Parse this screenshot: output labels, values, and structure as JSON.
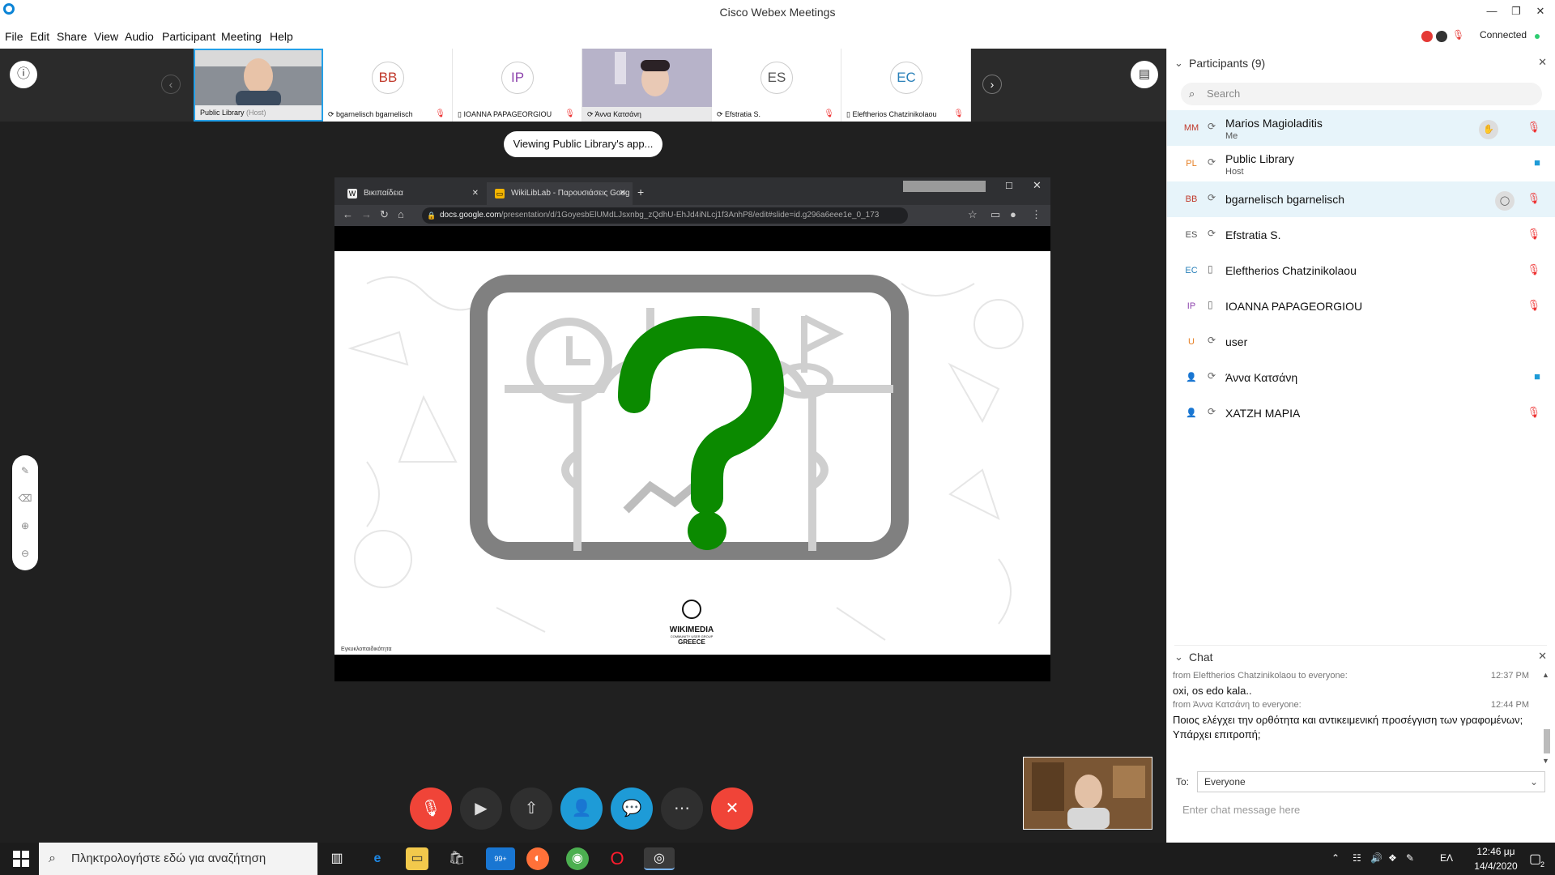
{
  "window": {
    "title": "Cisco Webex Meetings",
    "minimize": "—",
    "restore": "❐",
    "close": "✕"
  },
  "menu": [
    {
      "label": "File"
    },
    {
      "label": "Edit"
    },
    {
      "label": "Share"
    },
    {
      "label": "View"
    },
    {
      "label": "Audio"
    },
    {
      "label": "Participant"
    },
    {
      "label": "Meeting"
    },
    {
      "label": "Help"
    }
  ],
  "status": {
    "text": "Connected"
  },
  "strip": {
    "tiles": [
      {
        "initials": "",
        "name": "Public Library",
        "suffix": "(Host)",
        "video": true
      },
      {
        "initials": "BB",
        "name": "bgarnelisch bgarnelisch",
        "video": false
      },
      {
        "initials": "IP",
        "name": "IOANNA PAPAGEORGIOU",
        "video": false
      },
      {
        "initials": "",
        "name": "Άννα Κατσάνη",
        "video": true
      },
      {
        "initials": "ES",
        "name": "Efstratia S.",
        "video": false
      },
      {
        "initials": "EC",
        "name": "Eleftherios Chatzinikolaou",
        "video": false
      }
    ]
  },
  "stage": {
    "viewing_label": "Viewing Public Library's app..."
  },
  "browser": {
    "tabs": [
      {
        "title": "Βικιπαίδεια",
        "favicon": "W"
      },
      {
        "title": "WikiLibLab - Παρουσιάσεις Goog",
        "favicon": "▭"
      }
    ],
    "new_tab": "+",
    "url_host": "docs.google.com",
    "url_path": "/presentation/d/1GoyesbElUMdLJsxnbg_zQdhU-EhJd4iNLcj1f3AnhP8/edit#slide=id.g296a6eee1e_0_173",
    "slide_logo_main": "WIKIMEDIA",
    "slide_logo_sub": "COMMUNITY USER GROUP",
    "slide_logo_country": "GREECE",
    "slide_caption": "Εγκυκλοπαιδικότητα"
  },
  "participants": {
    "header": "Participants (9)",
    "search_placeholder": "Search",
    "list": [
      {
        "initials": "MM",
        "name": "Marios Magioladitis",
        "sub": "Me",
        "color": "#c0392b"
      },
      {
        "initials": "PL",
        "name": "Public Library",
        "sub": "Host",
        "color": "#e67e22"
      },
      {
        "initials": "BB",
        "name": "bgarnelisch bgarnelisch",
        "sub": "",
        "color": "#c0392b"
      },
      {
        "initials": "ES",
        "name": "Efstratia S.",
        "sub": "",
        "color": "#555555"
      },
      {
        "initials": "EC",
        "name": "Eleftherios Chatzinikolaou",
        "sub": "",
        "color": "#2980b9"
      },
      {
        "initials": "IP",
        "name": "IOANNA PAPAGEORGIOU",
        "sub": "",
        "color": "#8e44ad"
      },
      {
        "initials": "U",
        "name": "user",
        "sub": "",
        "color": "#e67e22"
      },
      {
        "initials": "",
        "name": "Άννα Κατσάνη",
        "sub": "",
        "color": "#555555"
      },
      {
        "initials": "",
        "name": "ΧΑΤΖΗ ΜΑΡΙΑ",
        "sub": "",
        "color": "#555555"
      }
    ]
  },
  "chat": {
    "header": "Chat",
    "messages": [
      {
        "from": "from Eleftherios Chatzinikolaou to everyone:",
        "time": "12:37 PM",
        "text": "oxi, os edo kala.."
      },
      {
        "from": "from Άννα Κατσάνη to everyone:",
        "time": "12:44 PM",
        "text": "Ποιος ελέγχει την ορθότητα και αντικειμενική προσέγγιση των γραφομένων; Υπάρχει επιτροπή;"
      }
    ],
    "to_label": "To:",
    "to_value": "Everyone",
    "input_placeholder": "Enter chat message here"
  },
  "taskbar": {
    "search_placeholder": "Πληκτρολογήστε εδώ για αναζήτηση",
    "mail_badge": "99+",
    "lang": "ΕΛ",
    "time": "12:46 μμ",
    "date": "14/4/2020",
    "notif_count": "2"
  }
}
